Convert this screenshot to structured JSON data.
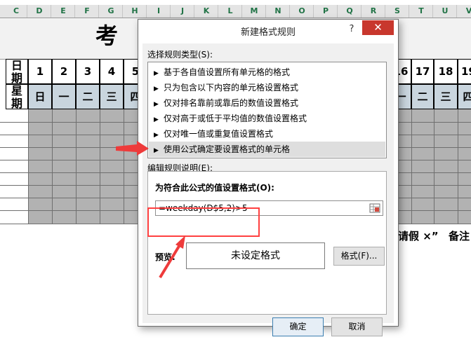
{
  "spreadsheet": {
    "columns": [
      "C",
      "D",
      "E",
      "F",
      "G",
      "H",
      "I",
      "J",
      "K",
      "L",
      "M",
      "N",
      "O",
      "P",
      "Q",
      "R",
      "S",
      "T",
      "U",
      "V"
    ],
    "title": "考 勤",
    "row_label_date": "日期",
    "row_label_weekday": "星期",
    "date_numbers_left": [
      "1",
      "2",
      "3",
      "4",
      "5"
    ],
    "date_numbers_right": [
      "16",
      "17",
      "18",
      "19"
    ],
    "weekdays_left": [
      "日",
      "一",
      "二",
      "三",
      "四"
    ],
    "weekdays_right": [
      "一",
      "二",
      "三",
      "四"
    ],
    "note_text": "请假 ×”",
    "note_text2": "备注"
  },
  "dialog": {
    "title": "新建格式规则",
    "help": "?",
    "close": "✕",
    "rule_type_label": "选择规则类型(S):",
    "rule_types": [
      "基于各自值设置所有单元格的格式",
      "只为包含以下内容的单元格设置格式",
      "仅对排名靠前或靠后的数值设置格式",
      "仅对高于或低于平均值的数值设置格式",
      "仅对唯一值或重复值设置格式",
      "使用公式确定要设置格式的单元格"
    ],
    "selected_rule_index": 5,
    "edit_desc_label": "编辑规则说明(E):",
    "formula_label": "为符合此公式的值设置格式(O):",
    "formula_value": "=weekday(D$5,2)>5",
    "preview_label": "预览:",
    "preview_text": "未设定格式",
    "format_button": "格式(F)...",
    "ok_button": "确定",
    "cancel_button": "取消"
  },
  "colors": {
    "accent_red": "#ff4040",
    "close_red": "#c8372d",
    "weekday_fill": "#c9d5de",
    "grid_fill": "#b2b2b2",
    "column_header_text": "#217346"
  },
  "icons": [
    "triangle-right-icon",
    "range-select-icon",
    "red-arrow-icon"
  ]
}
